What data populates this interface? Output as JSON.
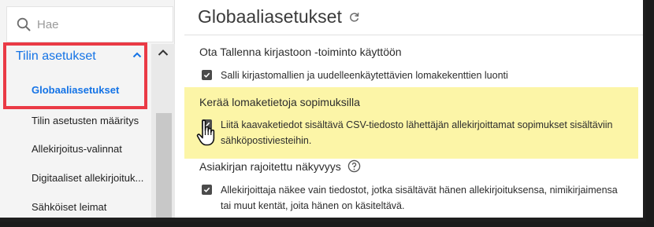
{
  "sidebar": {
    "search_placeholder": "Hae",
    "section_label": "Tilin asetukset",
    "items": [
      {
        "label": "Globaaliasetukset"
      },
      {
        "label": "Tilin asetusten määritys"
      },
      {
        "label": "Allekirjoitus-valinnat"
      },
      {
        "label": "Digitaaliset allekirjoituk..."
      },
      {
        "label": "Sähköiset leimat"
      }
    ]
  },
  "main": {
    "title": "Globaaliasetukset",
    "sections": [
      {
        "title": "Ota Tallenna kirjastoon -toiminto käyttöön",
        "option": "Salli kirjastomallien ja uudelleenkäytettävien lomakekenttien luonti"
      },
      {
        "title": "Kerää lomaketietoja sopimuksilla",
        "option_line1": "Liitä kaavaketiedot sisältävä CSV-tiedosto lähettäjän allekirjoittamat sopimukset sisältäviin",
        "option_line2": "sähköpostiviesteihin."
      },
      {
        "title": "Asiakirjan rajoitettu näkyvyys",
        "option_line1": "Allekirjoittaja näkee vain tiedostot, jotka sisältävät hänen allekirjoituksensa, nimikirjaimensa",
        "option_line2": "tai muut kentät, joita hänen on käsiteltävä."
      }
    ]
  },
  "colors": {
    "accent": "#1473e6",
    "highlight": "#fcf5a7",
    "callout": "#ea3a45"
  }
}
